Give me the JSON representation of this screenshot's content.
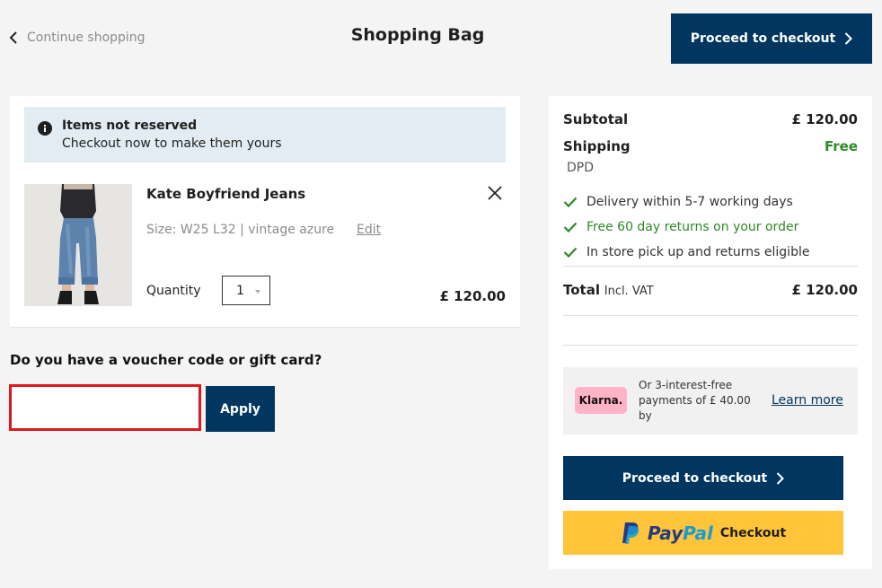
{
  "header": {
    "continue_label": "Continue shopping",
    "title": "Shopping Bag",
    "checkout_label": "Proceed to checkout"
  },
  "cart": {
    "notice_title": "Items not reserved",
    "notice_sub": "Checkout now to make them yours",
    "item": {
      "name": "Kate Boyfriend Jeans",
      "meta": "Size: W25 L32 | vintage azure",
      "edit_label": "Edit",
      "quantity_label": "Quantity",
      "quantity": "1",
      "price": "£ 120.00"
    }
  },
  "voucher": {
    "question": "Do you have a voucher code or gift card?",
    "input_value": "",
    "apply_label": "Apply"
  },
  "summary": {
    "subtotal_label": "Subtotal",
    "subtotal_value": "£ 120.00",
    "shipping_label": "Shipping",
    "shipping_value": "Free",
    "carrier": "DPD",
    "benefits": [
      "Delivery within 5-7 working days",
      "Free 60 day returns on your order",
      "In store pick up and returns eligible"
    ],
    "total_label": "Total",
    "total_incl": "Incl. VAT",
    "total_value": "£ 120.00",
    "klarna_logo": "Klarna.",
    "klarna_text": "Or 3-interest-free payments of £ 40.00 by",
    "klarna_link": "Learn more",
    "checkout_label": "Proceed to checkout",
    "paypal_pay": "Pay",
    "paypal_pal": "Pal",
    "paypal_checkout": "Checkout"
  },
  "colors": {
    "navy": "#003660",
    "free_green": "#2d8a23",
    "highlight_red": "#e0161e",
    "paypal_yellow": "#ffc439",
    "klarna_pink": "#ffb3c7"
  },
  "icons": [
    "chevron-left-icon",
    "chevron-right-icon",
    "info-icon",
    "close-icon",
    "check-icon",
    "paypal-logo-icon"
  ]
}
